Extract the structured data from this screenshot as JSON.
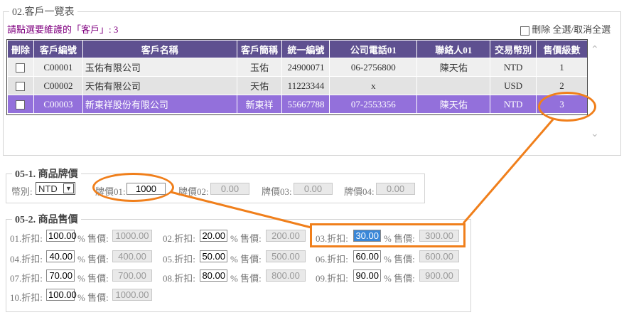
{
  "customers": {
    "legend": "02.客戶一覽表",
    "hint": "請點選要維護的「客戶」: 3",
    "delete_label": "刪除",
    "select_all_label": "全選/取消全選",
    "columns": [
      "刪除",
      "客戶編號",
      "客戶名稱",
      "客戶簡稱",
      "統一編號",
      "公司電話01",
      "聯絡人01",
      "交易幣別",
      "售價級數"
    ],
    "rows": [
      {
        "id": "C00001",
        "name": "玉佑有限公司",
        "short": "玉佑",
        "tax": "24900071",
        "phone": "06-2756800",
        "contact": "陳天佑",
        "currency": "NTD",
        "level": "1"
      },
      {
        "id": "C00002",
        "name": "天佑有限公司",
        "short": "天佑",
        "tax": "11223344",
        "phone": "x",
        "contact": "",
        "currency": "USD",
        "level": "2"
      },
      {
        "id": "C00003",
        "name": "新東祥股份有限公司",
        "short": "新東祥",
        "tax": "55667788",
        "phone": "07-2553356",
        "contact": "陳天佑",
        "currency": "NTD",
        "level": "3"
      }
    ]
  },
  "price": {
    "legend": "05-1. 商品牌價",
    "currency_label": "幣別:",
    "currency_value": "NTD",
    "labels": [
      "牌價01:",
      "牌價02:",
      "牌價03:",
      "牌價04:"
    ],
    "values": [
      "1000",
      "0.00",
      "0.00",
      "0.00"
    ]
  },
  "sale": {
    "legend": "05-2. 商品售價",
    "discount_labels": [
      "01.折扣:",
      "02.折扣:",
      "03.折扣:",
      "04.折扣:",
      "05.折扣:",
      "06.折扣:",
      "07.折扣:",
      "08.折扣:",
      "09.折扣:",
      "10.折扣:"
    ],
    "discounts": [
      "100.00",
      "20.00",
      "30.00",
      "40.00",
      "50.00",
      "60.00",
      "70.00",
      "80.00",
      "90.00",
      "100.00"
    ],
    "pct_label": "% 售價:",
    "prices": [
      "1000.00",
      "200.00",
      "300.00",
      "400.00",
      "500.00",
      "600.00",
      "700.00",
      "800.00",
      "900.00",
      "1000.00"
    ]
  },
  "colors": {
    "header": "#5e5090",
    "selected_row": "#9370db",
    "annotation": "#f07f1b",
    "hint": "#800080"
  }
}
